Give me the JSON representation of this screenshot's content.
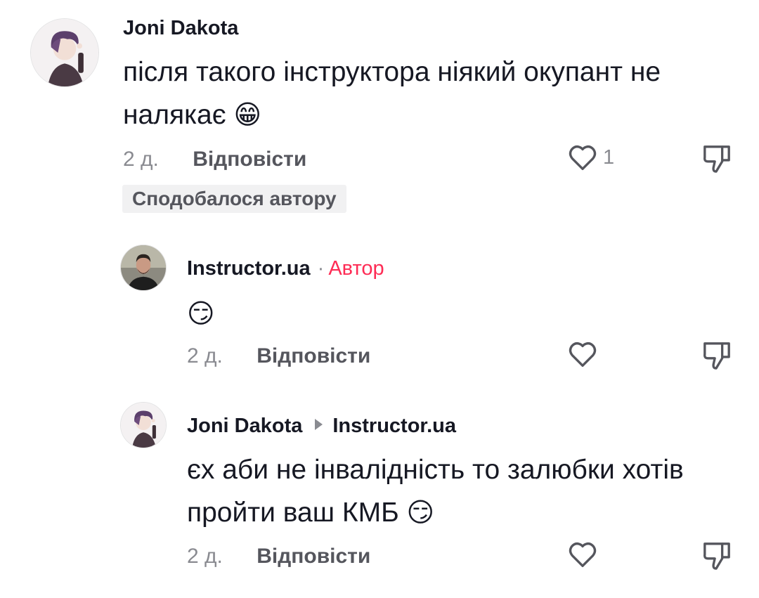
{
  "comments": [
    {
      "username": "Joni Dakota",
      "text_line1": "після такого інструктора ніякий окупант не",
      "text_line2": "налякає",
      "emoji": "😁",
      "time": "2 д.",
      "reply": "Відповісти",
      "likes": "1",
      "badge": "Сподобалося автору"
    },
    {
      "username": "Instructor.ua",
      "separator": "·",
      "author_tag": "Автор",
      "emoji": "😏",
      "time": "2 д.",
      "reply": "Відповісти"
    },
    {
      "username": "Joni Dakota",
      "reply_to": "Instructor.ua",
      "text_line1": "єх аби не інвалідність то залюбки хотів",
      "text_line2": "пройти ваш КМБ",
      "emoji": "😏",
      "time": "2 д.",
      "reply": "Відповісти"
    }
  ],
  "icons": {
    "like": "heart-outline-icon",
    "dislike": "thumbs-down-icon"
  },
  "colors": {
    "author_tag": "#fe2c55",
    "secondary_text": "#8a8b91",
    "badge_bg": "#f1f1f2"
  }
}
